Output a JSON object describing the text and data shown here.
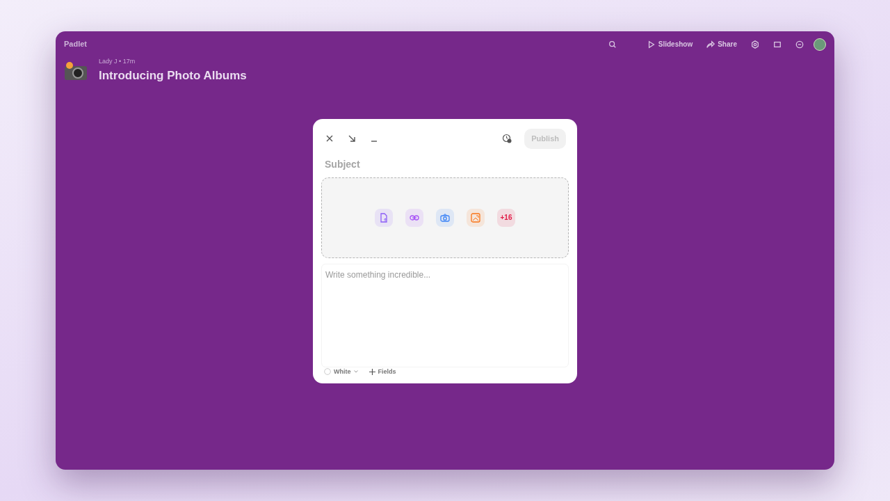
{
  "app": {
    "logo": "Padlet"
  },
  "toolbar": [
    {
      "kind": "search"
    },
    {
      "kind": "slideshow",
      "label": "Slideshow"
    },
    {
      "kind": "share",
      "label": "Share"
    },
    {
      "kind": "settings"
    },
    {
      "kind": "remake"
    },
    {
      "kind": "more"
    },
    {
      "kind": "avatar"
    }
  ],
  "board": {
    "author_line": "Lady J • 17m",
    "title": "Introducing Photo Albums"
  },
  "composer": {
    "publish": {
      "label": "Publish",
      "disabled": true
    },
    "subject": {
      "placeholder": "Subject"
    },
    "attachments": [
      {
        "kind": "file",
        "color": "#8b5cf6"
      },
      {
        "kind": "link",
        "color": "#a855f7"
      },
      {
        "kind": "camera",
        "color": "#3b82f6"
      },
      {
        "kind": "image",
        "color": "#f97316"
      },
      {
        "kind": "more",
        "label": "+16",
        "color": "#e11d48"
      }
    ],
    "body": {
      "placeholder": "Write something incredible..."
    },
    "color_picker": {
      "label": "White"
    },
    "fields_button": {
      "label": "Fields"
    }
  }
}
